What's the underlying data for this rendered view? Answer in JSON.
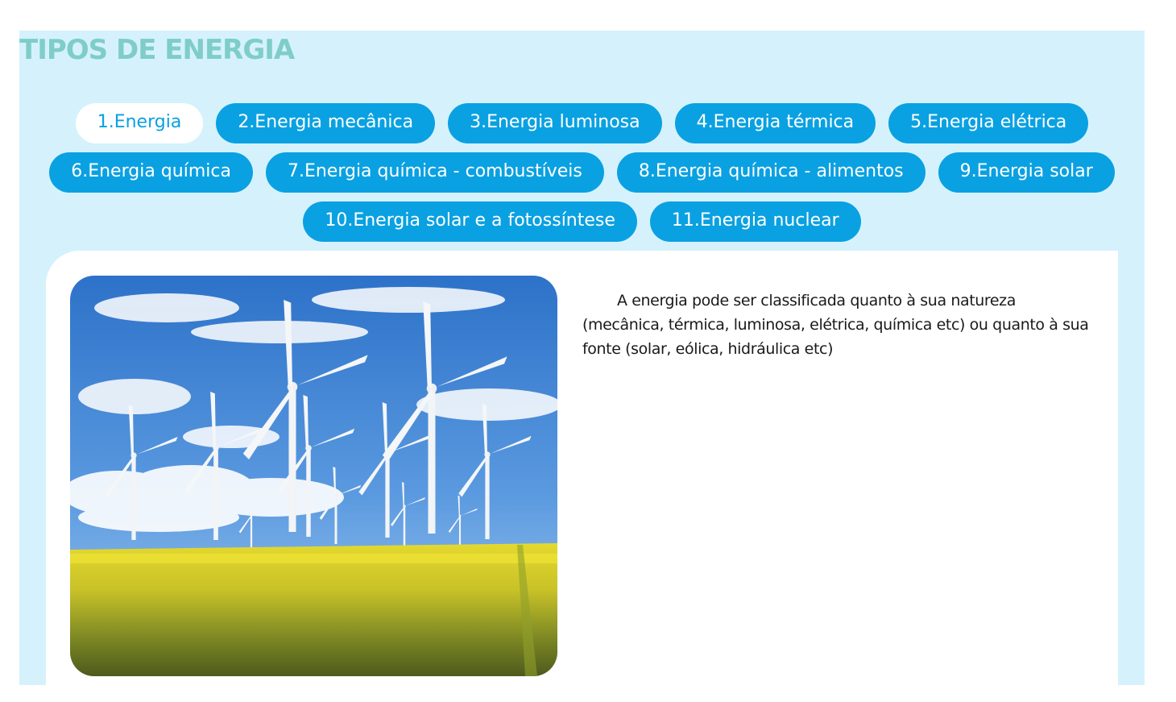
{
  "page": {
    "title": "TIPOS DE ENERGIA"
  },
  "tabs": [
    [
      {
        "label": "1.Energia",
        "active": true
      },
      {
        "label": "2.Energia mecânica",
        "active": false
      },
      {
        "label": "3.Energia luminosa",
        "active": false
      },
      {
        "label": "4.Energia térmica",
        "active": false
      },
      {
        "label": "5.Energia elétrica",
        "active": false
      }
    ],
    [
      {
        "label": "6.Energia química",
        "active": false
      },
      {
        "label": "7.Energia química - combustíveis",
        "active": false
      },
      {
        "label": "8.Energia química - alimentos",
        "active": false
      },
      {
        "label": "9.Energia solar",
        "active": false
      }
    ],
    [
      {
        "label": "10.Energia solar e a fotossíntese",
        "active": false
      },
      {
        "label": "11.Energia nuclear",
        "active": false
      }
    ]
  ],
  "content": {
    "image_subject": "wind-turbines-field",
    "description": "A energia pode ser classificada quanto à sua natureza (mecânica, térmica, luminosa, elétrica, química etc) ou quanto à sua fonte (solar, eólica, hidráulica etc)"
  },
  "colors": {
    "panel_bg": "#d5f2fc",
    "title": "#7fcdc9",
    "tab_bg": "#0aa1e2",
    "tab_text": "#ffffff",
    "tab_active_bg": "#ffffff",
    "tab_active_text": "#0aa1e2"
  }
}
